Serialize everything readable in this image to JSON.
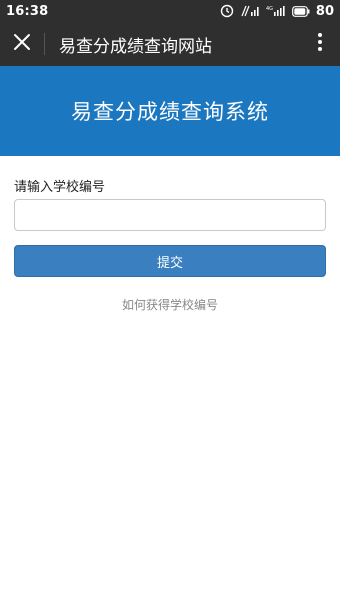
{
  "status_bar": {
    "time": "16:38",
    "battery": "80",
    "icons": [
      "alarm-icon",
      "signal-hd-icon",
      "signal-4g-icon",
      "battery-icon"
    ]
  },
  "nav_bar": {
    "title": "易查分成绩查询网站",
    "close_icon": "close-icon",
    "more_icon": "more-vert-icon"
  },
  "hero": {
    "title": "易查分成绩查询系统"
  },
  "form": {
    "label": "请输入学校编号",
    "input_value": "",
    "submit_label": "提交",
    "help_link": "如何获得学校编号"
  }
}
